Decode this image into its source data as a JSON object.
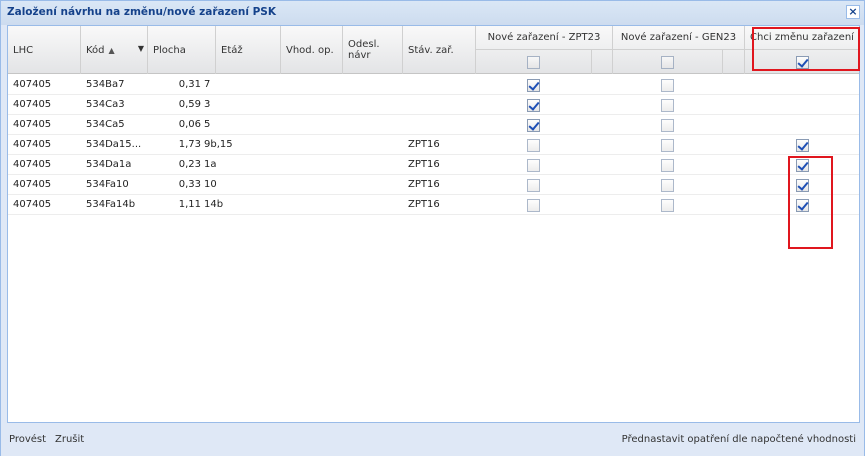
{
  "dialog": {
    "title": "Založení návrhu na změnu/nové zařazení PSK",
    "close_glyph": "×"
  },
  "columns": {
    "lhc": "LHC",
    "kod": "Kód",
    "kod_sort": "▲",
    "kod_menu": "▼",
    "plocha": "Plocha",
    "etaz": "Etáž",
    "vhod_op": "Vhod. op.",
    "odesl_navrh": "Odesl. návr",
    "stav_zar": "Stáv. zař.",
    "nove_zpt23": "Nové zařazení - ZPT23",
    "nove_gen23": "Nové zařazení - GEN23",
    "chci_zmenu": "Chci změnu zařazení"
  },
  "header_checks": {
    "zpt23": false,
    "gen23": false,
    "chci": true
  },
  "rows": [
    {
      "lhc": "407405",
      "kod": "534Ba7",
      "plocha": "0,31",
      "etaz": "7",
      "stav": "",
      "zpt23": true,
      "gen23": false,
      "chci": null
    },
    {
      "lhc": "407405",
      "kod": "534Ca3",
      "plocha": "0,59",
      "etaz": "3",
      "stav": "",
      "zpt23": true,
      "gen23": false,
      "chci": null
    },
    {
      "lhc": "407405",
      "kod": "534Ca5",
      "plocha": "0,06",
      "etaz": "5",
      "stav": "",
      "zpt23": true,
      "gen23": false,
      "chci": null
    },
    {
      "lhc": "407405",
      "kod": "534Da15...",
      "plocha": "1,73",
      "etaz": "9b,15",
      "stav": "ZPT16",
      "zpt23": false,
      "gen23": false,
      "chci": true
    },
    {
      "lhc": "407405",
      "kod": "534Da1a",
      "plocha": "0,23",
      "etaz": "1a",
      "stav": "ZPT16",
      "zpt23": false,
      "gen23": false,
      "chci": true
    },
    {
      "lhc": "407405",
      "kod": "534Fa10",
      "plocha": "0,33",
      "etaz": "10",
      "stav": "ZPT16",
      "zpt23": false,
      "gen23": false,
      "chci": true
    },
    {
      "lhc": "407405",
      "kod": "534Fa14b",
      "plocha": "1,11",
      "etaz": "14b",
      "stav": "ZPT16",
      "zpt23": false,
      "gen23": false,
      "chci": true
    }
  ],
  "footer": {
    "provest": "Provést",
    "zrusit": "Zrušit",
    "prednastavit": "Přednastavit opatření dle napočtené vhodnosti"
  },
  "colors": {
    "highlight": "#e0161e",
    "title": "#15428b",
    "check": "#1e4fb5"
  }
}
